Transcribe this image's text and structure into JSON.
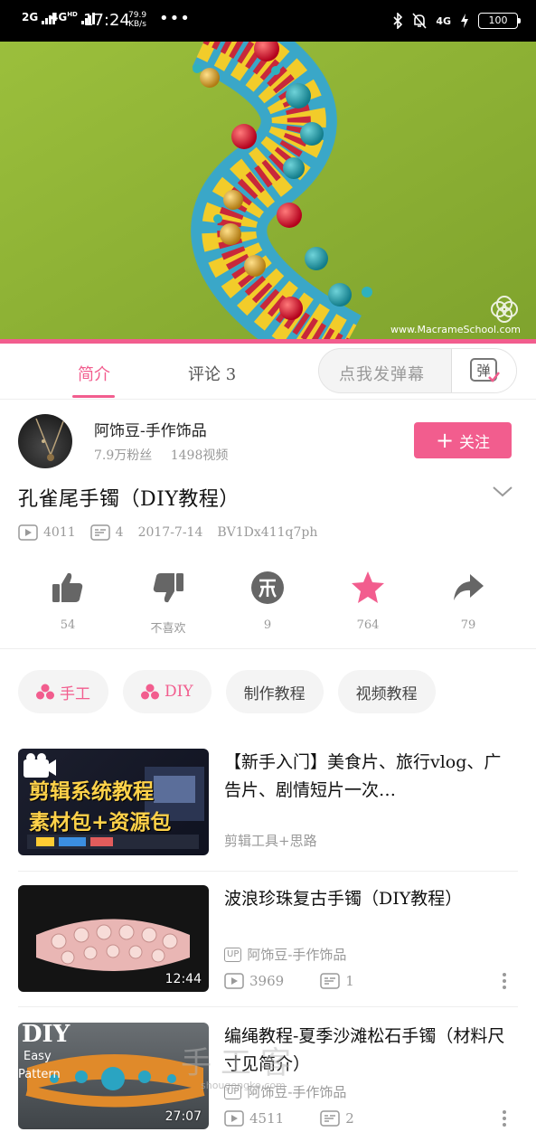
{
  "status_bar": {
    "signal_1": "2G",
    "signal_2": "4G",
    "signal_2_sup": "HD",
    "time": "17:24",
    "speed_value": "79.9",
    "speed_unit": "KB/s",
    "dots": "•••",
    "net_right": "4G",
    "battery": "100"
  },
  "video": {
    "watermark": "www.MacrameSchool.com",
    "colors": {
      "background": "#8cb23a",
      "accent": "#f25d8e"
    }
  },
  "tabs": {
    "intro": "简介",
    "comments": "评论 3",
    "danmu_placeholder": "点我发弹幕",
    "danmu_button": "弹"
  },
  "uploader": {
    "name": "阿饰豆-手作饰品",
    "fans": "7.9万粉丝",
    "videos": "1498视频",
    "follow_label": "关注",
    "follow_plus": "+"
  },
  "video_info": {
    "title": "孔雀尾手镯（DIY教程）",
    "views": "4011",
    "danmaku": "4",
    "date": "2017-7-14",
    "bvid": "BV1Dx411q7ph"
  },
  "actions": [
    {
      "icon": "like-icon",
      "label": "54"
    },
    {
      "icon": "dislike-icon",
      "label": "不喜欢"
    },
    {
      "icon": "coin-icon",
      "label": "9"
    },
    {
      "icon": "star-icon",
      "label": "764"
    },
    {
      "icon": "share-icon",
      "label": "79"
    }
  ],
  "tags": [
    {
      "label": "手工",
      "icon": "channel-icon",
      "pink": true
    },
    {
      "label": "DIY",
      "icon": "channel-icon",
      "pink": true
    },
    {
      "label": "制作教程",
      "pink": false
    },
    {
      "label": "视频教程",
      "pink": false
    }
  ],
  "related": [
    {
      "title": "【新手入门】美食片、旅行vlog、广告片、剧情短片一次…",
      "thumb_line1": "剪辑系统教程",
      "thumb_line2": "素材包+资源包",
      "sub": "剪辑工具+思路"
    },
    {
      "title": "波浪珍珠复古手镯（DIY教程）",
      "up_badge": "UP",
      "up": "阿饰豆-手作饰品",
      "views": "3969",
      "danmaku": "1",
      "duration": "12:44"
    },
    {
      "title": "编绳教程-夏季沙滩松石手镯（材料尺寸见简介）",
      "up_badge": "UP",
      "up": "阿饰豆-手作饰品",
      "views": "4511",
      "danmaku": "2",
      "duration": "27:07",
      "thumb_diy": "DIY",
      "thumb_easy": "Easy",
      "thumb_pattern": "Pattern"
    }
  ],
  "page_watermark": {
    "main": "手工客",
    "sub": "shougongke.com"
  }
}
